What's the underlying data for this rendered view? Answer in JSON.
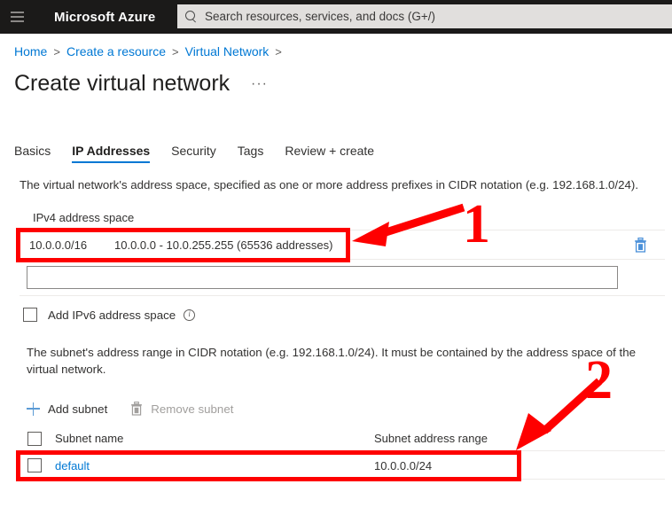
{
  "topbar": {
    "menu_icon": "hamburger-icon",
    "brand": "Microsoft Azure",
    "search": {
      "icon": "search-icon",
      "placeholder": "Search resources, services, and docs (G+/)",
      "value": ""
    }
  },
  "breadcrumb": {
    "items": [
      "Home",
      "Create a resource",
      "Virtual Network"
    ],
    "separator": ">",
    "trailing_separator": ">"
  },
  "page": {
    "title": "Create virtual network",
    "more_menu": "···"
  },
  "tabs": [
    {
      "label": "Basics",
      "active": false
    },
    {
      "label": "IP Addresses",
      "active": true
    },
    {
      "label": "Security",
      "active": false
    },
    {
      "label": "Tags",
      "active": false
    },
    {
      "label": "Review + create",
      "active": false
    }
  ],
  "address_space": {
    "description": "The virtual network's address space, specified as one or more address prefixes in CIDR notation (e.g. 192.168.1.0/24).",
    "label": "IPv4 address space",
    "rows": [
      {
        "cidr": "10.0.0.0/16",
        "range": "10.0.0.0 - 10.0.255.255 (65536 addresses)",
        "delete_icon": "trash-icon"
      }
    ],
    "new_entry": {
      "value": "",
      "placeholder": ""
    },
    "ipv6": {
      "label": "Add IPv6 address space",
      "checked": false,
      "info_icon": "info-icon"
    }
  },
  "subnets": {
    "description": "The subnet's address range in CIDR notation (e.g. 192.168.1.0/24). It must be contained by the address space of the virtual network.",
    "commands": [
      {
        "label": "Add subnet",
        "icon": "plus-icon",
        "enabled": true
      },
      {
        "label": "Remove subnet",
        "icon": "trash-icon",
        "enabled": false
      }
    ],
    "columns": [
      "Subnet name",
      "Subnet address range"
    ],
    "rows": [
      {
        "checked": false,
        "name": "default",
        "range": "10.0.0.0/24"
      }
    ]
  },
  "annotations": [
    {
      "number": "1",
      "target": "ipv4-address-space-row",
      "color": "#fe0000"
    },
    {
      "number": "2",
      "target": "subnet-default-row",
      "color": "#fe0000"
    }
  ],
  "colors": {
    "accent": "#0078d4",
    "topbar_bg": "#1b1a19",
    "annotation": "#fe0000",
    "link": "#0078d4"
  }
}
